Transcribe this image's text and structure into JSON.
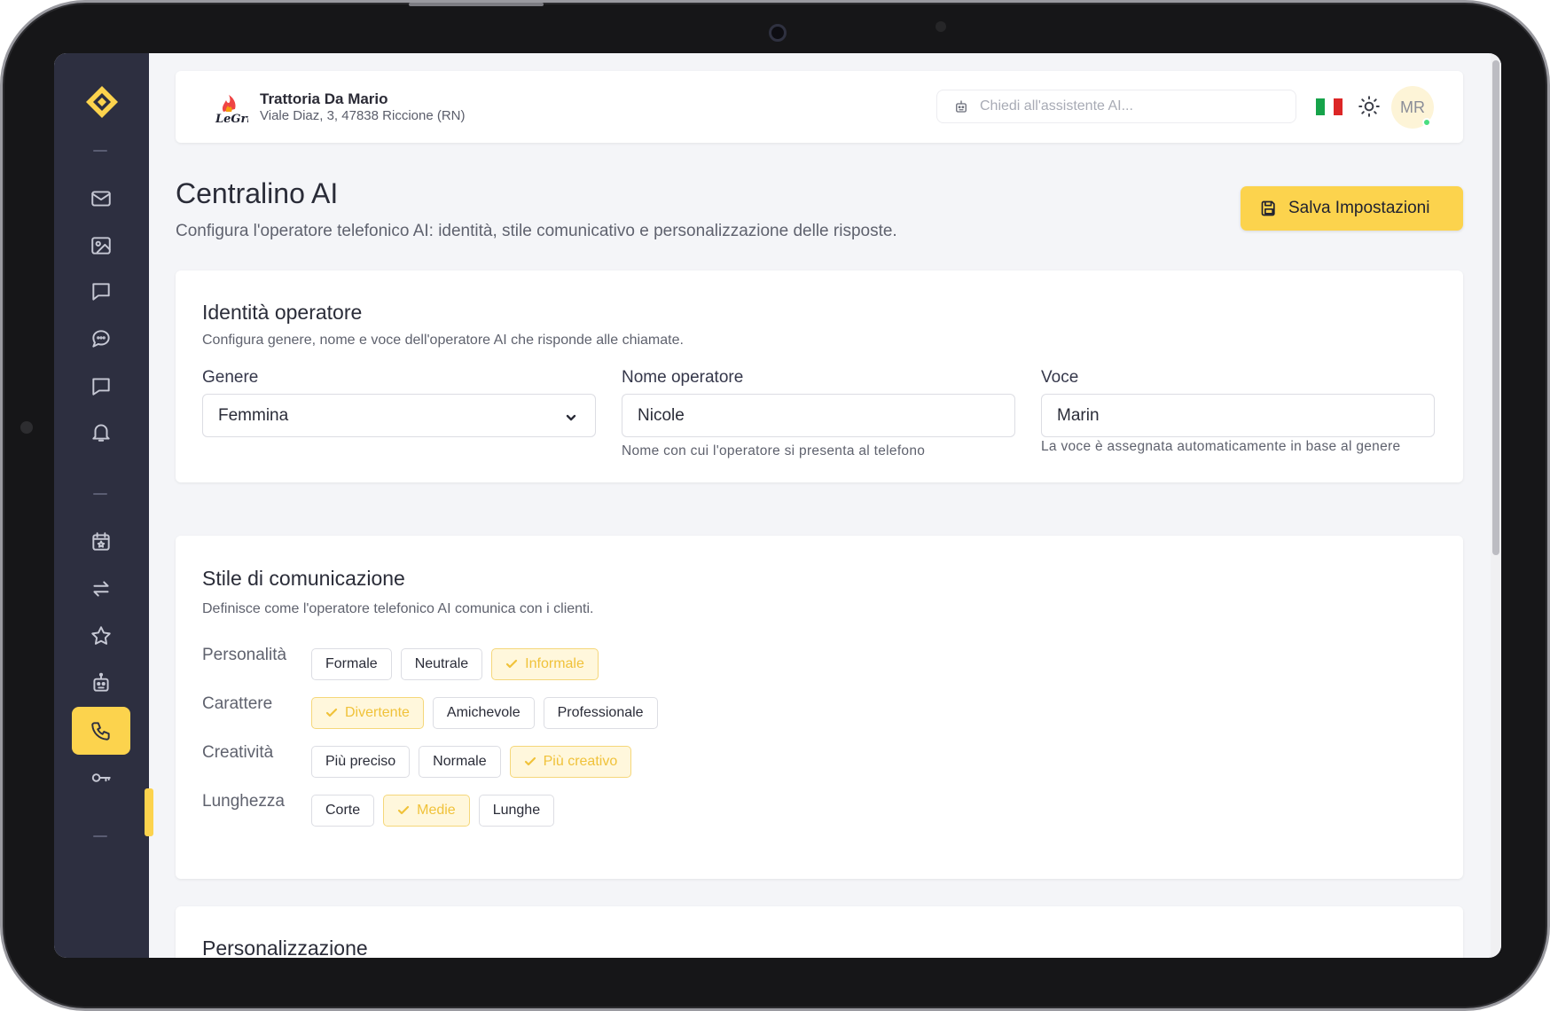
{
  "header": {
    "restaurant_name": "Trattoria Da Mario",
    "restaurant_address": "Viale Diaz, 3, 47838 Riccione (RN)",
    "ai_search_placeholder": "Chiedi all'assistente AI...",
    "avatar_initials": "MR",
    "language_flag": "it"
  },
  "page": {
    "title": "Centralino AI",
    "subtitle": "Configura l'operatore telefonico AI: identità, stile comunicativo e personalizzazione delle risposte.",
    "save_label": "Salva Impostazioni"
  },
  "identity": {
    "title": "Identità operatore",
    "subtitle": "Configura genere, nome e voce dell'operatore AI che risponde alle chiamate.",
    "gender_label": "Genere",
    "gender_value": "Femmina",
    "name_label": "Nome operatore",
    "name_value": "Nicole",
    "name_hint": "Nome con cui l'operatore si presenta al telefono",
    "voice_label": "Voce",
    "voice_value": "Marin",
    "voice_hint": "La voce è assegnata automaticamente in base al genere"
  },
  "style": {
    "title": "Stile di comunicazione",
    "subtitle": "Definisce come l'operatore telefonico AI comunica con i clienti.",
    "rows": [
      {
        "label": "Personalità",
        "options": [
          "Formale",
          "Neutrale",
          "Informale"
        ],
        "selected": 2
      },
      {
        "label": "Carattere",
        "options": [
          "Divertente",
          "Amichevole",
          "Professionale"
        ],
        "selected": 0
      },
      {
        "label": "Creatività",
        "options": [
          "Più preciso",
          "Normale",
          "Più creativo"
        ],
        "selected": 2
      },
      {
        "label": "Lunghezza",
        "options": [
          "Corte",
          "Medie",
          "Lunghe"
        ],
        "selected": 1
      }
    ]
  },
  "personalization": {
    "title": "Personalizzazione"
  },
  "colors": {
    "sidebar": "#2d2f40",
    "accent": "#fcd34d",
    "selected_chip_bg": "#fff7dc",
    "selected_chip_text": "#f0c23a"
  },
  "sidebar": {
    "icons": [
      "mail-icon",
      "image-icon",
      "message-square-icon",
      "chat-bubble-icon",
      "message-icon",
      "bell-icon",
      "calendar-star-icon",
      "arrows-exchange-icon",
      "star-icon",
      "robot-icon",
      "phone-icon",
      "key-icon"
    ],
    "active": "phone-icon"
  }
}
